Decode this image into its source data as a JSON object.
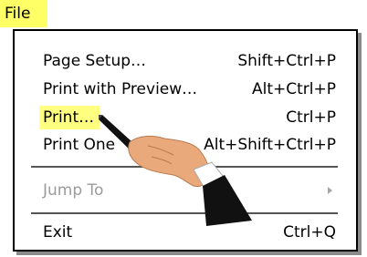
{
  "menu_title": "File",
  "menu_items": [
    {
      "label": "Page Setup…",
      "shortcut": "Shift+Ctrl+P"
    },
    {
      "label": "Print with Preview…",
      "shortcut": "Alt+Ctrl+P"
    },
    {
      "label": "Print…",
      "shortcut": "Ctrl+P",
      "highlighted": true
    },
    {
      "label": "Print One",
      "shortcut": "Alt+Shift+Ctrl+P"
    },
    {
      "label": "Jump To",
      "shortcut": "",
      "disabled": true,
      "has_submenu": true
    },
    {
      "label": "Exit",
      "shortcut": "Ctrl+Q"
    }
  ],
  "colors": {
    "highlight": "#ffff80",
    "menu_title_bg": "#ffff66",
    "disabled_text": "#9b9b9b",
    "border": "#000000"
  },
  "icons": {
    "jump_to_arrow": "chevron-right-icon",
    "pointer": "pointing-hand-icon"
  }
}
